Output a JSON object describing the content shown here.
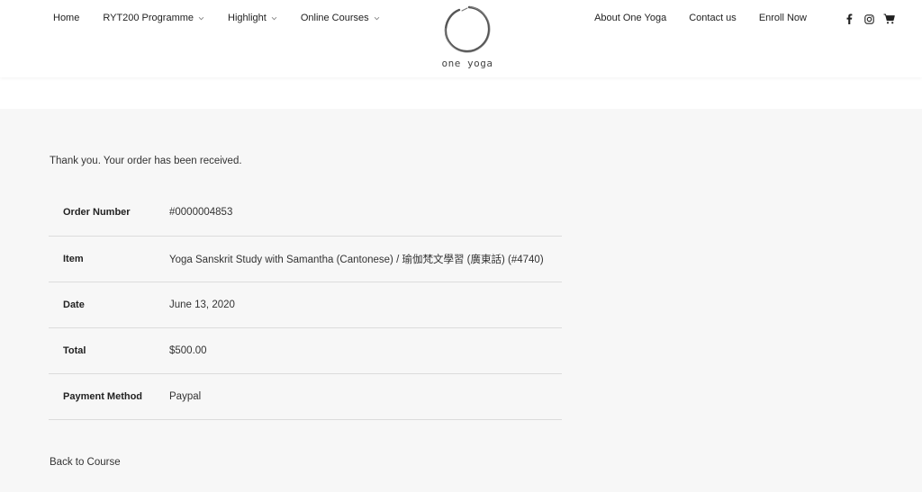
{
  "nav": {
    "left": [
      {
        "label": "Home",
        "has_dropdown": false
      },
      {
        "label": "RYT200 Programme",
        "has_dropdown": true
      },
      {
        "label": "Highlight",
        "has_dropdown": true
      },
      {
        "label": "Online Courses",
        "has_dropdown": true
      }
    ],
    "right": [
      {
        "label": "About One Yoga"
      },
      {
        "label": "Contact us"
      },
      {
        "label": "Enroll Now"
      }
    ],
    "social_icons": [
      "facebook-icon",
      "instagram-icon",
      "cart-icon"
    ]
  },
  "logo": {
    "text": "one yoga",
    "icon": "enso-circle-icon"
  },
  "order": {
    "thank_you": "Thank you. Your order has been received.",
    "rows": [
      {
        "label": "Order Number",
        "value": "#0000004853"
      },
      {
        "label": "Item",
        "value": "Yoga Sanskrit Study with Samantha (Cantonese) / 瑜伽梵文學習 (廣東話) (#4740)"
      },
      {
        "label": "Date",
        "value": "June 13, 2020"
      },
      {
        "label": "Total",
        "value": "$500.00"
      },
      {
        "label": "Payment Method",
        "value": "Paypal"
      }
    ],
    "back_link": "Back to Course"
  },
  "colors": {
    "page_bg": "#f7f7f7",
    "header_bg": "#ffffff",
    "text": "#222222",
    "divider": "#dcdcdc"
  }
}
